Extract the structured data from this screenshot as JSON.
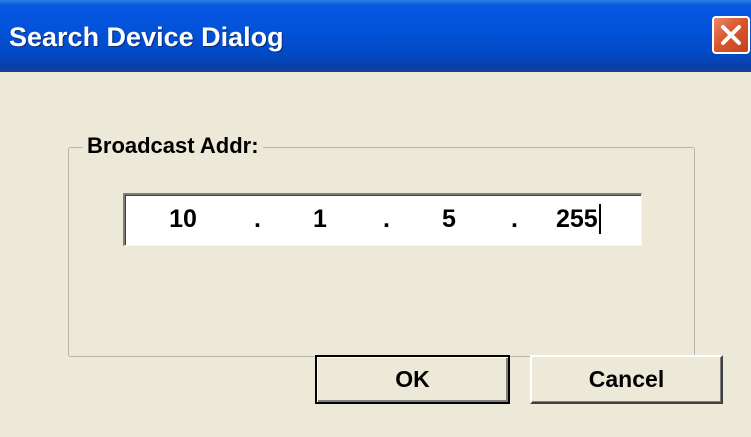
{
  "window": {
    "title": "Search Device Dialog",
    "close_icon": "close-icon"
  },
  "group": {
    "label": "Broadcast Addr:"
  },
  "ip_address": {
    "octets": [
      "10",
      "1",
      "5",
      "255"
    ],
    "separator": "."
  },
  "buttons": {
    "ok_label": "OK",
    "cancel_label": "Cancel"
  },
  "colors": {
    "titlebar": "#0353d9",
    "dialog_background": "#ece9d8",
    "close_button": "#d9582f"
  }
}
